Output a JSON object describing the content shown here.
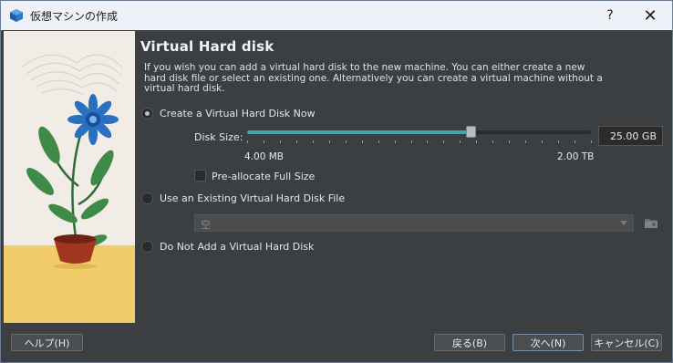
{
  "window": {
    "title": "仮想マシンの作成",
    "help_glyph": "?",
    "close_glyph": "✕"
  },
  "page": {
    "heading": "Virtual Hard disk",
    "description": "If you wish you can add a virtual hard disk to the new machine. You can either create a new hard disk file or select an existing one. Alternatively you can create a virtual machine without a virtual hard disk."
  },
  "options": {
    "create_new": {
      "label": "Create a Virtual Hard Disk Now",
      "checked": true
    },
    "use_existing": {
      "label": "Use an Existing Virtual Hard Disk File",
      "checked": false
    },
    "no_disk": {
      "label": "Do Not Add a Virtual Hard Disk",
      "checked": false
    }
  },
  "disk_size": {
    "label": "Disk Size:",
    "min_label": "4.00 MB",
    "max_label": "2.00 TB",
    "value_text": "25.00 GB",
    "slider_fraction": 0.65
  },
  "preallocate": {
    "label": "Pre-allocate Full Size",
    "checked": false
  },
  "existing_file_combo": {
    "value": "空"
  },
  "buttons": {
    "help": "ヘルプ(H)",
    "back": "戻る(B)",
    "next": "次へ(N)",
    "cancel": "キャンセル(C)"
  },
  "colors": {
    "accent": "#4aa3a8",
    "background": "#3c3f41",
    "titlebar": "#eef2f8"
  },
  "icons": [
    "virtualbox-icon",
    "help-icon",
    "close-icon",
    "folder-icon",
    "chevron-down-icon",
    "plant-illustration"
  ]
}
